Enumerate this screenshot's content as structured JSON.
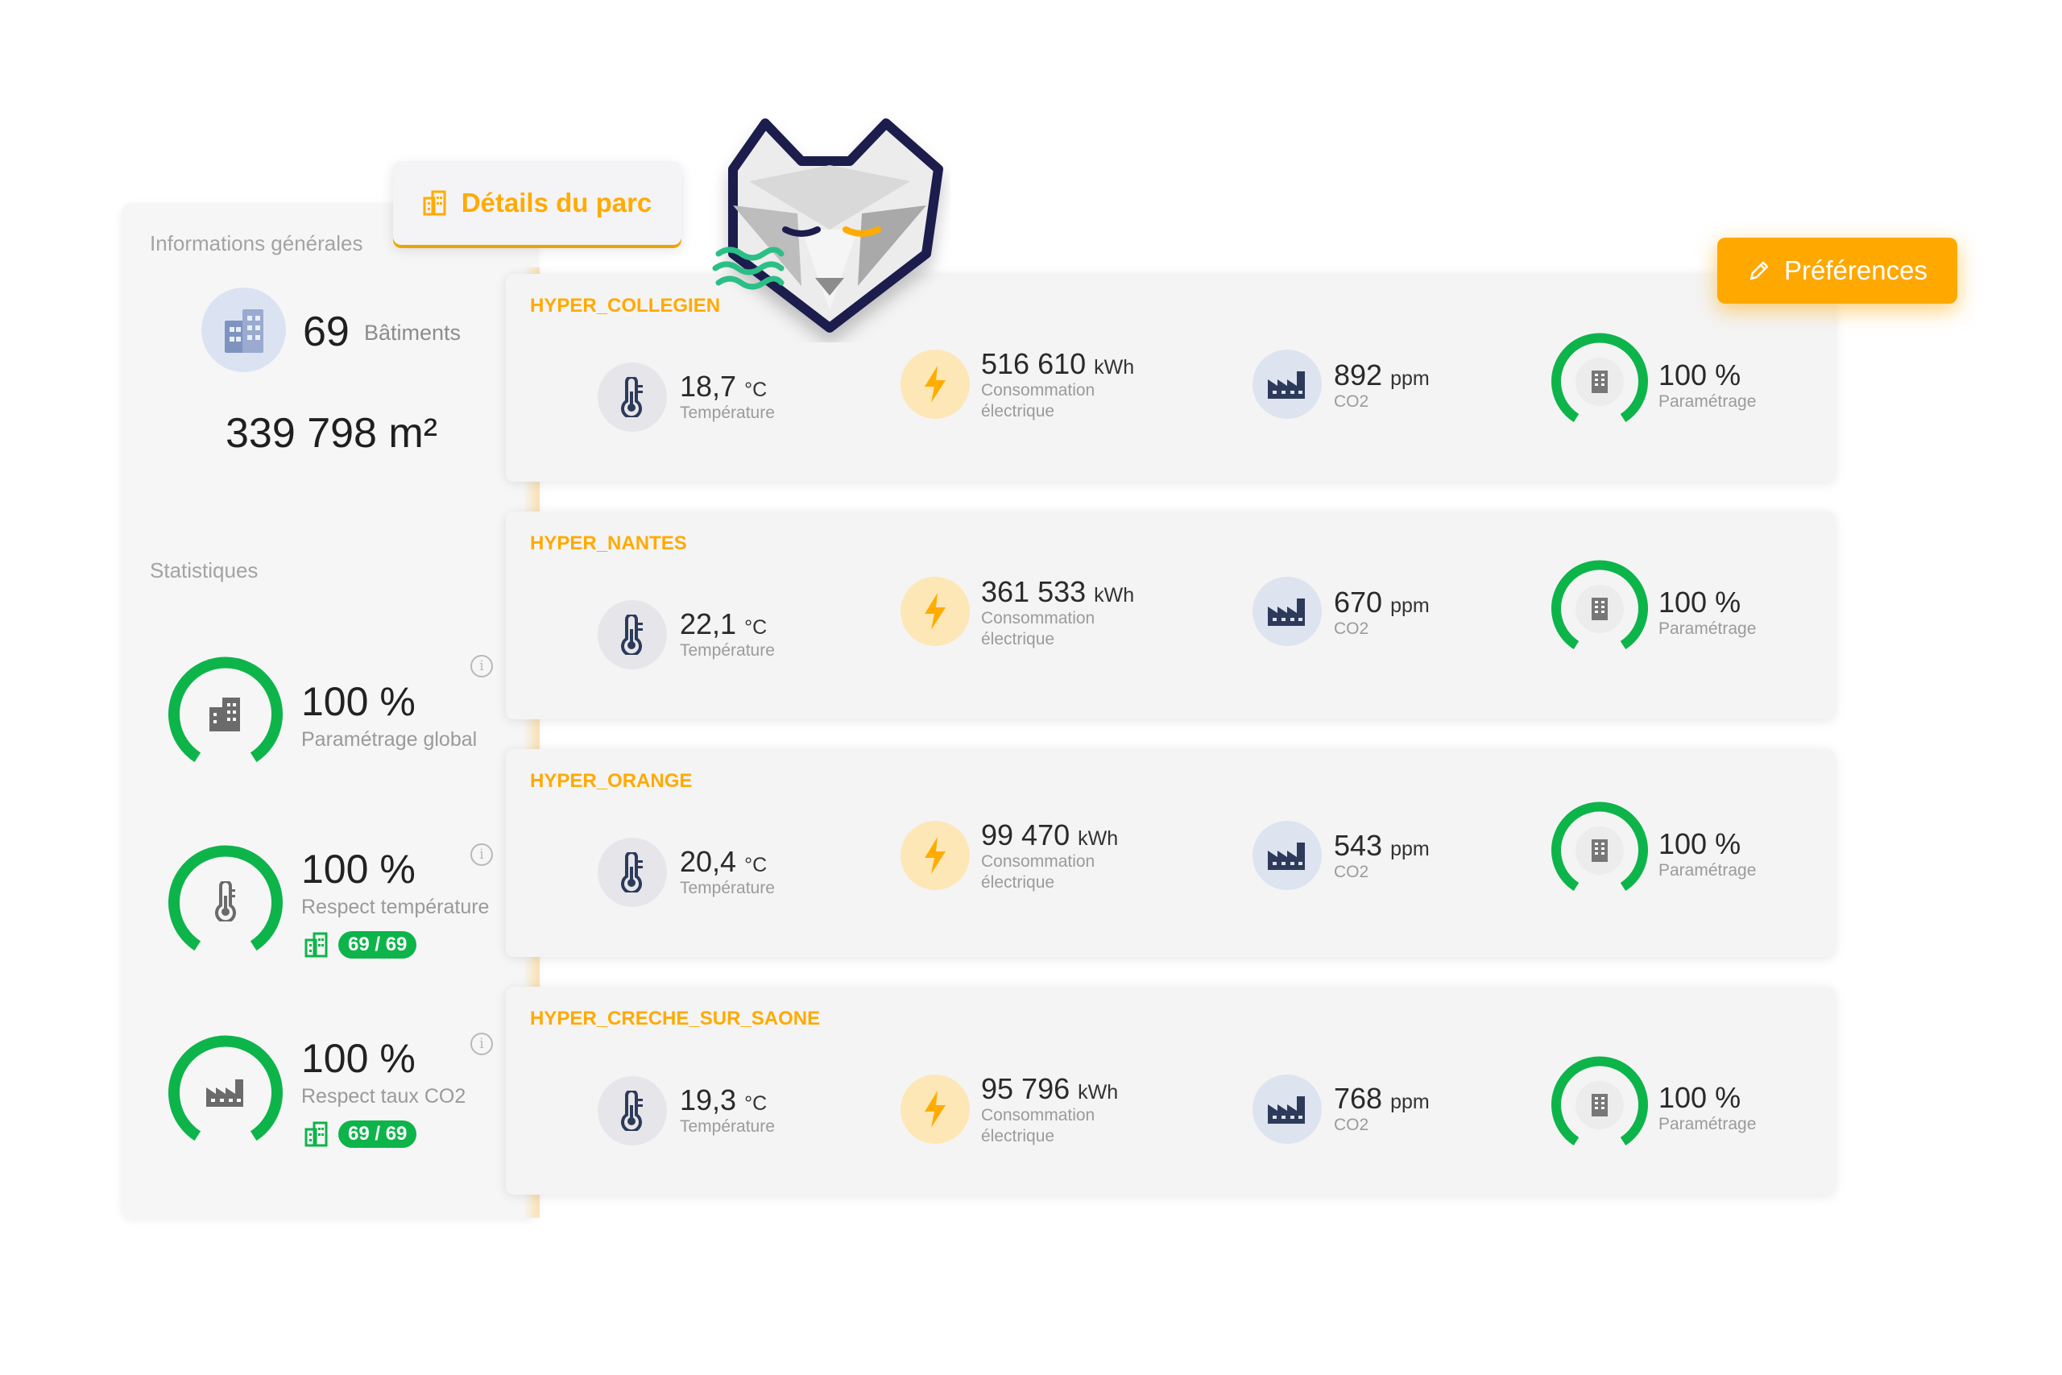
{
  "tab": {
    "label": "Détails du parc"
  },
  "preferences": {
    "label": "Préférences"
  },
  "sidebar": {
    "info_title": "Informations générales",
    "buildings_count": "69",
    "buildings_label": "Bâtiments",
    "surface": "339 798 m²",
    "stats_title": "Statistiques",
    "stats": [
      {
        "pct": "100 %",
        "label": "Paramétrage global",
        "icon": "building-icon"
      },
      {
        "pct": "100 %",
        "label": "Respect température",
        "icon": "thermometer-icon",
        "badge": "69 / 69"
      },
      {
        "pct": "100 %",
        "label": "Respect taux CO2",
        "icon": "factory-icon",
        "badge": "69 / 69"
      }
    ]
  },
  "units": {
    "temp": "°C",
    "temp_label": "Température",
    "kwh": "kWh",
    "elec_label_1": "Consommation",
    "elec_label_2": "électrique",
    "ppm": "ppm",
    "co2_label": "CO2",
    "param_label": "Paramétrage"
  },
  "sites": [
    {
      "name": "HYPER_COLLEGIEN",
      "temp": "18,7",
      "kwh": "516 610",
      "ppm": "892",
      "param": "100 %"
    },
    {
      "name": "HYPER_NANTES",
      "temp": "22,1",
      "kwh": "361 533",
      "ppm": "670",
      "param": "100 %"
    },
    {
      "name": "HYPER_ORANGE",
      "temp": "20,4",
      "kwh": "99 470",
      "ppm": "543",
      "param": "100 %"
    },
    {
      "name": "HYPER_CRECHE_SUR_SAONE",
      "temp": "19,3",
      "kwh": "95 796",
      "ppm": "768",
      "param": "100 %"
    }
  ],
  "colors": {
    "accent": "#ffa800",
    "gauge_green": "#0db44a",
    "icon_navy": "#2d3a5a"
  }
}
